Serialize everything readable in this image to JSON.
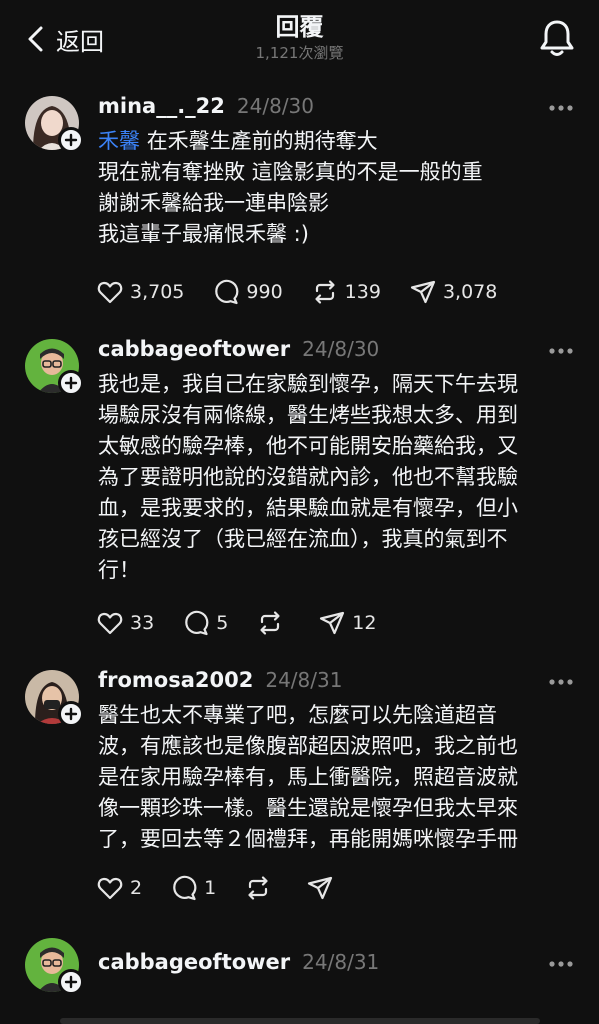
{
  "header": {
    "back_label": "返回",
    "title": "回覆",
    "subtitle": "1,121次瀏覽"
  },
  "posts": [
    {
      "username": "mina__._22",
      "date": "24/8/30",
      "mention": "禾馨",
      "lines": [
        "在禾馨生產前的期待奪大",
        "現在就有奪挫敗 這陰影真的不是一般的重",
        "謝謝禾馨給我一連串陰影",
        "我這輩子最痛恨禾馨 :)"
      ],
      "likes": "3,705",
      "comments": "990",
      "reposts": "139",
      "shares": "3,078"
    },
    {
      "username": "cabbageoftower",
      "date": "24/8/30",
      "lines": [
        "我也是，我自己在家驗到懷孕，隔天下午去現",
        "場驗尿沒有兩條線，醫生烤些我想太多、用到",
        "太敏感的驗孕棒，他不可能開安胎藥給我，又",
        "為了要證明他說的沒錯就內診，他也不幫我驗",
        "血，是我要求的，結果驗血就是有懷孕，但小",
        "孩已經沒了（我已經在流血），我真的氣到不",
        "行！"
      ],
      "likes": "33",
      "comments": "5",
      "reposts": "",
      "shares": "12"
    },
    {
      "username": "fromosa2002",
      "date": "24/8/31",
      "lines": [
        "醫生也太不專業了吧，怎麼可以先陰道超音",
        "波，有應該也是像腹部超因波照吧，我之前也",
        "是在家用驗孕棒有，馬上衝醫院，照超音波就",
        "像一顆珍珠一樣。醫生還說是懷孕但我太早來",
        "了，要回去等２個禮拜，再能開媽咪懷孕手冊"
      ],
      "likes": "2",
      "comments": "1",
      "reposts": "",
      "shares": ""
    },
    {
      "username": "cabbageoftower",
      "date": "24/8/31"
    }
  ],
  "colors": {
    "background": "#101010",
    "text": "#f3f5f7",
    "muted": "#777777",
    "mention": "#3b82f6"
  }
}
